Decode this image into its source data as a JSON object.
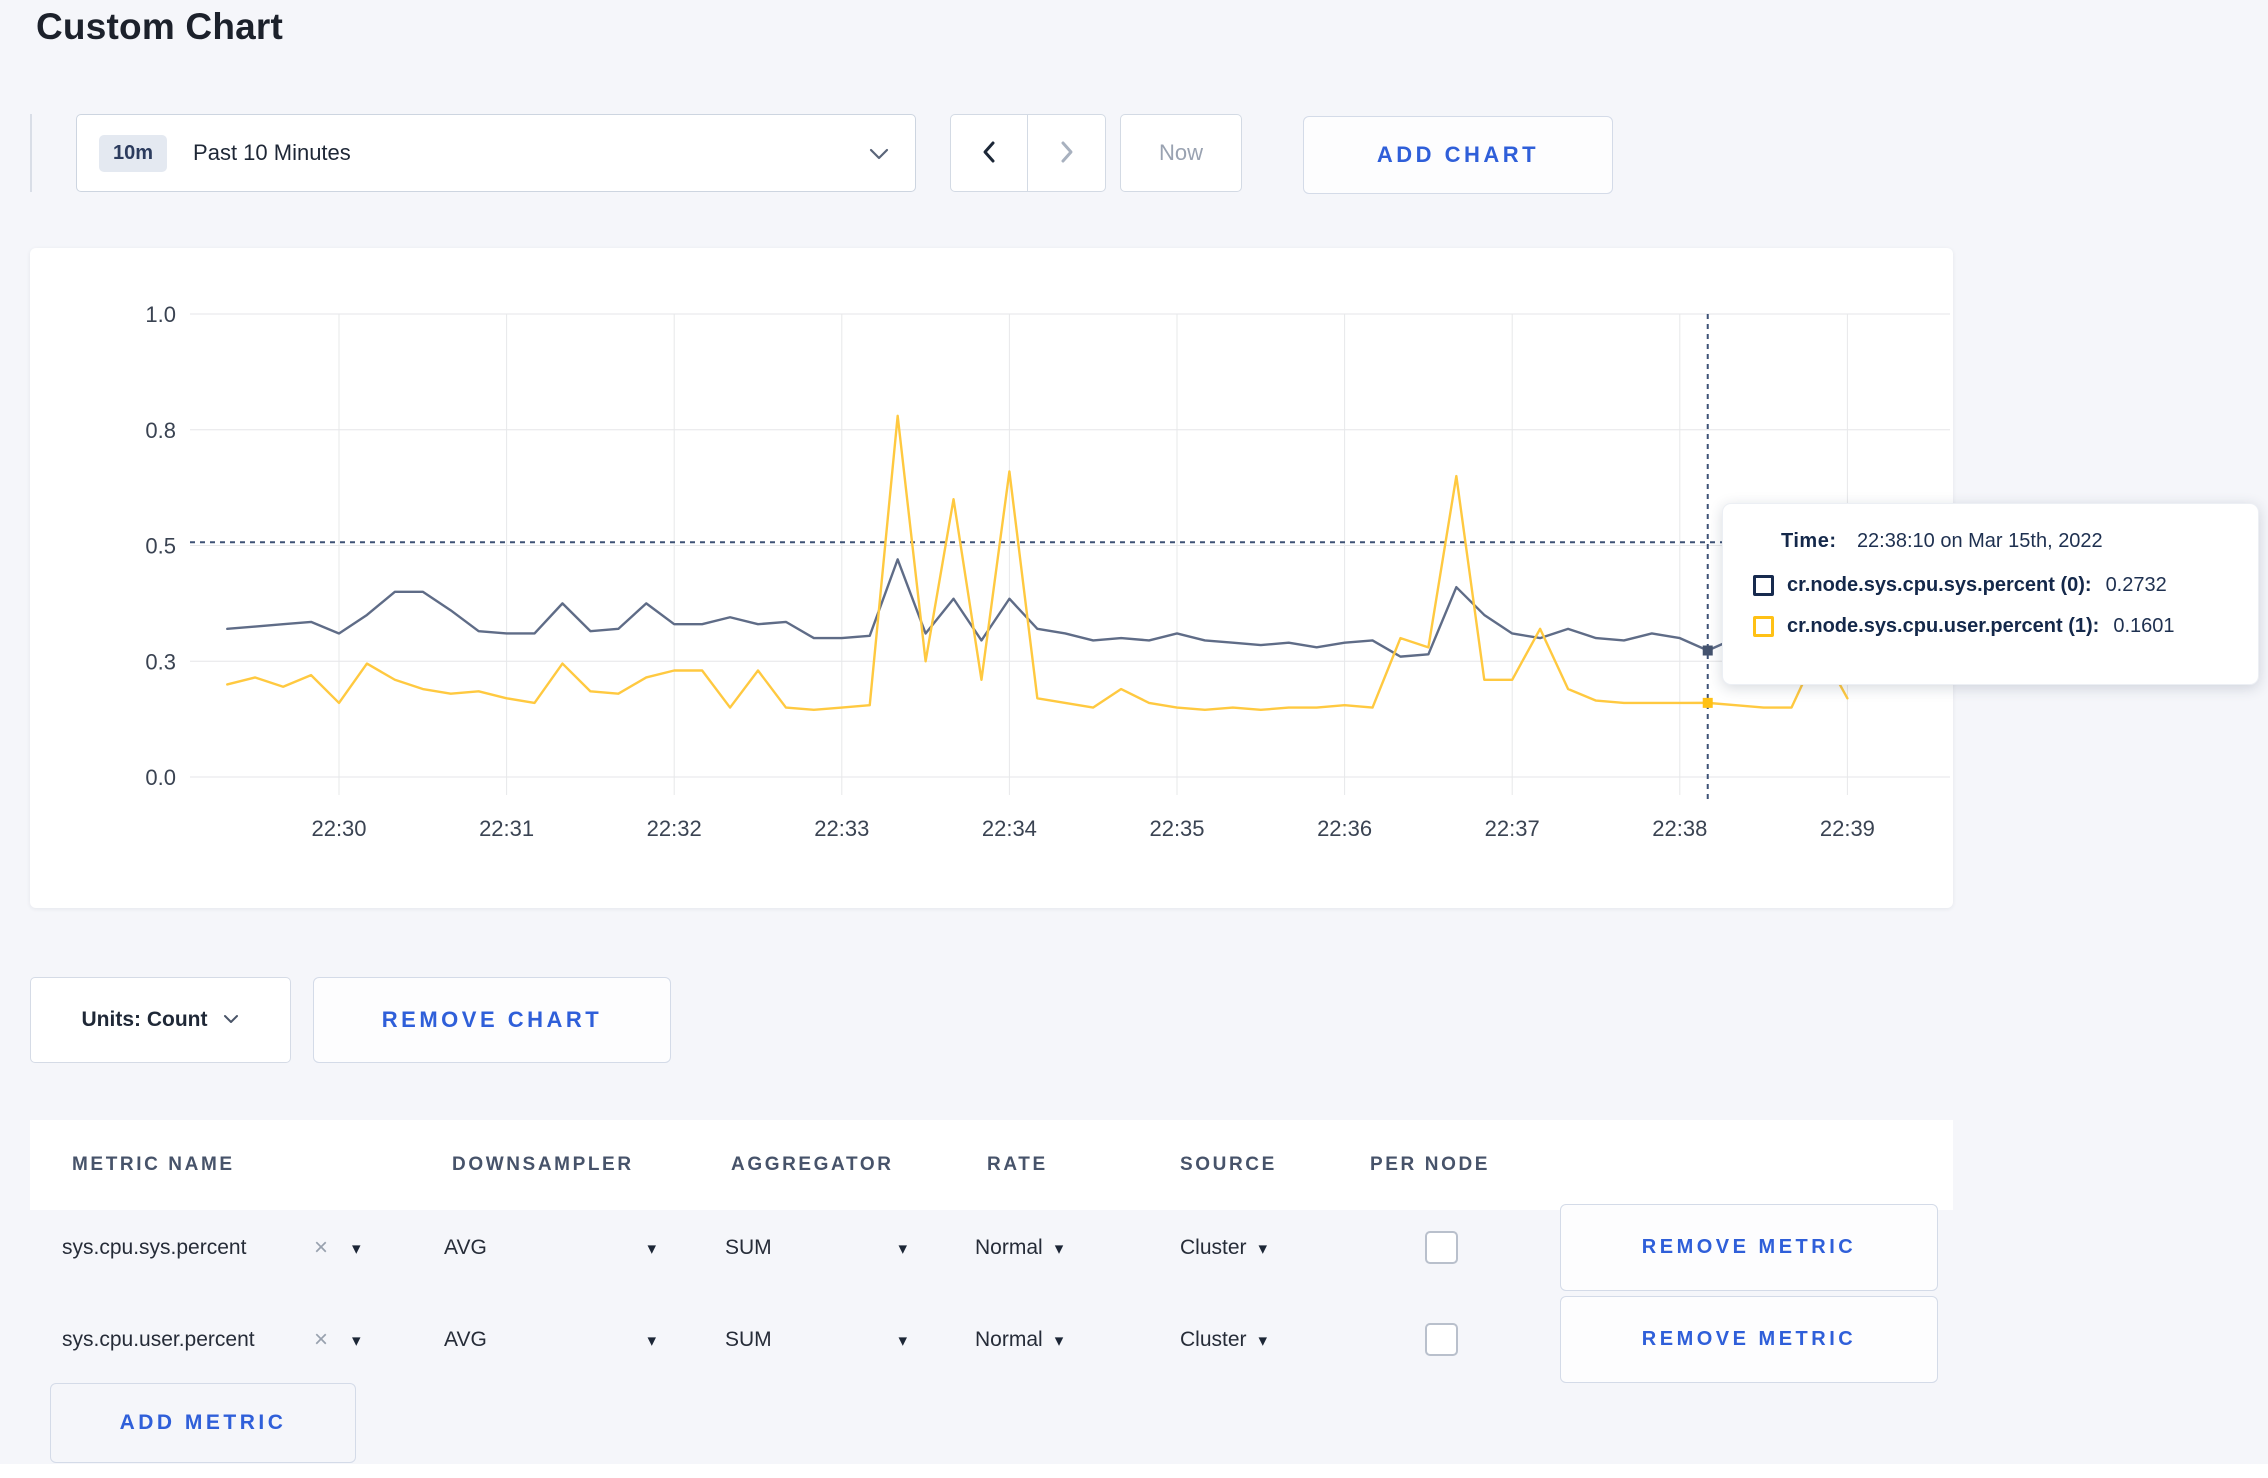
{
  "page": {
    "title": "Custom Chart"
  },
  "toolbar": {
    "time_window_badge": "10m",
    "time_window_label": "Past 10 Minutes",
    "now_label": "Now",
    "add_chart_label": "ADD CHART"
  },
  "chart_data": {
    "type": "line",
    "x_start": "22:29:20",
    "x_interval_seconds": 10,
    "x_tick_labels": [
      "22:30",
      "22:31",
      "22:32",
      "22:33",
      "22:34",
      "22:35",
      "22:36",
      "22:37",
      "22:38",
      "22:39"
    ],
    "y_tick_labels": [
      "0.0",
      "0.3",
      "0.5",
      "0.8",
      "1.0"
    ],
    "y_tick_values": [
      0,
      0.25,
      0.5,
      0.75,
      1.0
    ],
    "ylim": [
      0,
      1
    ],
    "grid": true,
    "legend_position": "tooltip",
    "series": [
      {
        "name": "cr.node.sys.cpu.sys.percent (0)",
        "color": "#5f6c87",
        "dot_color": "#44536e",
        "values": [
          0.32,
          0.325,
          0.33,
          0.335,
          0.31,
          0.35,
          0.4,
          0.4,
          0.36,
          0.315,
          0.31,
          0.31,
          0.375,
          0.315,
          0.32,
          0.375,
          0.33,
          0.33,
          0.345,
          0.33,
          0.335,
          0.3,
          0.3,
          0.305,
          0.47,
          0.31,
          0.385,
          0.295,
          0.385,
          0.32,
          0.31,
          0.295,
          0.3,
          0.295,
          0.31,
          0.295,
          0.29,
          0.285,
          0.29,
          0.28,
          0.29,
          0.295,
          0.26,
          0.265,
          0.41,
          0.35,
          0.31,
          0.3,
          0.32,
          0.3,
          0.295,
          0.31,
          0.3,
          0.2732,
          0.3,
          0.295,
          0.285,
          0.28,
          0.295
        ]
      },
      {
        "name": "cr.node.sys.cpu.user.percent (1)",
        "color": "#ffc940",
        "dot_color": "#ffc115",
        "values": [
          0.2,
          0.215,
          0.195,
          0.22,
          0.16,
          0.245,
          0.21,
          0.19,
          0.18,
          0.185,
          0.17,
          0.16,
          0.245,
          0.185,
          0.18,
          0.215,
          0.23,
          0.23,
          0.15,
          0.23,
          0.15,
          0.145,
          0.15,
          0.155,
          0.78,
          0.25,
          0.6,
          0.21,
          0.66,
          0.17,
          0.16,
          0.15,
          0.19,
          0.16,
          0.15,
          0.145,
          0.15,
          0.145,
          0.15,
          0.15,
          0.155,
          0.15,
          0.3,
          0.28,
          0.65,
          0.21,
          0.21,
          0.32,
          0.19,
          0.165,
          0.16,
          0.16,
          0.16,
          0.1601,
          0.155,
          0.15,
          0.15,
          0.28,
          0.17
        ]
      }
    ],
    "crosshair": {
      "time": "22:38:10",
      "index": 53,
      "h_line_value": 0.507,
      "color": "#3d5175"
    }
  },
  "tooltip": {
    "time_label": "Time:",
    "time_value": "22:38:10 on Mar 15th, 2022",
    "rows": [
      {
        "label": "cr.node.sys.cpu.sys.percent (0):",
        "value": "0.2732",
        "color": "#172a4e"
      },
      {
        "label": "cr.node.sys.cpu.user.percent (1):",
        "value": "0.1601",
        "color": "#ffc115"
      }
    ]
  },
  "chart_controls": {
    "units_label": "Units: Count",
    "remove_chart_label": "REMOVE CHART"
  },
  "metrics_table": {
    "headers": [
      "METRIC NAME",
      "DOWNSAMPLER",
      "AGGREGATOR",
      "RATE",
      "SOURCE",
      "PER NODE"
    ],
    "clear_icon": "×",
    "rows": [
      {
        "metric_name": "sys.cpu.sys.percent",
        "downsampler": "AVG",
        "aggregator": "SUM",
        "rate": "Normal",
        "source": "Cluster",
        "per_node_checked": false,
        "remove_label": "REMOVE METRIC"
      },
      {
        "metric_name": "sys.cpu.user.percent",
        "downsampler": "AVG",
        "aggregator": "SUM",
        "rate": "Normal",
        "source": "Cluster",
        "per_node_checked": false,
        "remove_label": "REMOVE METRIC"
      }
    ],
    "add_metric_label": "ADD METRIC"
  }
}
